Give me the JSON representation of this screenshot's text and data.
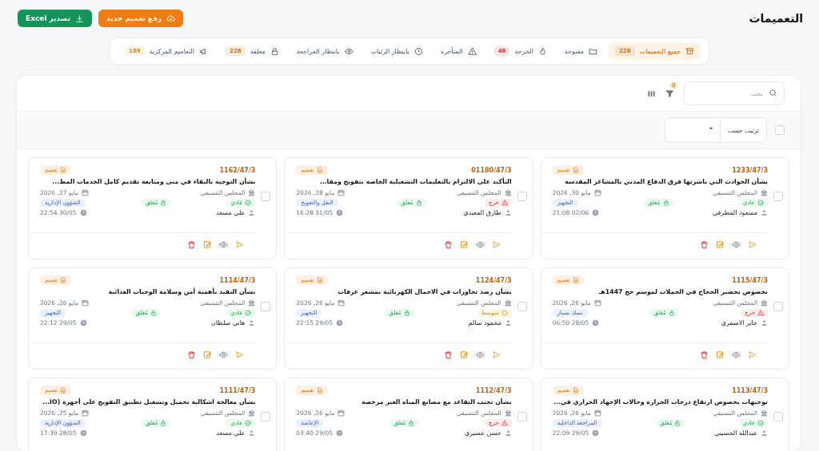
{
  "header": {
    "title": "التعميمات",
    "buttons": [
      {
        "label": "رفع تعميم جديد",
        "kind": "upload"
      },
      {
        "label": "تصدير Excel",
        "kind": "export"
      }
    ]
  },
  "tabs": [
    {
      "label": "جميع التعميمات",
      "count": "228",
      "color": "#d2700c",
      "selected": true
    },
    {
      "label": "مفتوحة",
      "selected": false
    },
    {
      "label": "الحرجة",
      "count": "48",
      "color": "#dd3333",
      "selected": false
    },
    {
      "label": "المتأخرة",
      "selected": false
    },
    {
      "label": "بانتظار الرئيات",
      "selected": false
    },
    {
      "label": "بانتظار المراجعة",
      "selected": false
    },
    {
      "label": "مغلقة",
      "count": "228",
      "color": "#d2700c",
      "selected": false
    },
    {
      "label": "التعاميم المركزية",
      "count": "189",
      "color": "#c99a06",
      "selected": false
    }
  ],
  "toolbar": {
    "search_placeholder": "بحث",
    "filter_count": "0"
  },
  "sort": {
    "label": "ترتيب حسب",
    "select_all_checked": false
  },
  "cards": [
    {
      "ref": "1233/47/3",
      "type": "تعميم",
      "title": "بشأن الحوادث التي باشرتها فرق الدفاع المدني بالمشاعر المقدسة",
      "council": "المجلس التنسيقي",
      "date": "مايو 30, 2026",
      "priority": {
        "kind": "normal",
        "label": "عادي"
      },
      "status": "مُغلق",
      "department": "التجهيز",
      "owner": "مسعود المطرفي",
      "time": "02/06 21:08",
      "checked": false
    },
    {
      "ref": "01180/47/3",
      "type": "تعميم",
      "title": "التأكيد على الالتزام بالتعليمات التشغيلية الخاصة بتفويج ومفا...",
      "council": "المجلس التنسيقي",
      "date": "مايو 28, 2026",
      "priority": {
        "kind": "critical",
        "label": "حرج"
      },
      "status": "مُغلق",
      "department": "النقل والتفويج",
      "owner": "طارق المعبدي",
      "time": "31/05 16:28",
      "checked": false
    },
    {
      "ref": "1162/47/3",
      "type": "تعميم",
      "title": "بشأن التوجيه بالبقاء في منى ومتابعة تقديم كامل الخدمات المط...",
      "council": "المجلس التنسيقي",
      "date": "مايو 27, 2026",
      "priority": {
        "kind": "normal",
        "label": "عادي"
      },
      "status": "مُغلق",
      "department": "الشؤون الإدارية",
      "owner": "علي مسعد",
      "time": "30/05 22:54",
      "checked": false
    },
    {
      "ref": "1115/47/3",
      "type": "تعميم",
      "title": "بخصوص تحضير الحجاج في الحملات لموسم حج 1447هـ",
      "council": "المجلس التنسيقي",
      "date": "مايو 26, 2026",
      "priority": {
        "kind": "critical",
        "label": "حرج"
      },
      "status": "مُغلق",
      "department": "نسك مسار",
      "owner": "جابر الاسمري",
      "time": "28/05 06:50",
      "checked": false
    },
    {
      "ref": "1124/47/3",
      "type": "تعميم",
      "title": "بشأن رصد تجاوزات في الاحمال الكهربائية بمشعر عرفات",
      "council": "المجلس التنسيقي",
      "date": "مايو 26, 2026",
      "priority": {
        "kind": "medium",
        "label": "متوسط"
      },
      "status": "مُغلق",
      "department": "التجهيز",
      "owner": "محمود سالم",
      "time": "29/05 22:15",
      "checked": false
    },
    {
      "ref": "1114/47/3",
      "type": "تعميم",
      "title": "بشأن التقيد بأهمية أمن وسلامة الوجبات الغذائية",
      "council": "المجلس التنسيقي",
      "date": "مايو 26, 2026",
      "priority": {
        "kind": "normal",
        "label": "عادي"
      },
      "status": "مُغلق",
      "department": "التجهيز",
      "owner": "هاني سلطان",
      "time": "29/05 22:12",
      "checked": false
    },
    {
      "ref": "1113/47/3",
      "type": "تعميم",
      "title": "توجيهات بخصوص ارتفاع درجات الحرارة وحالات الإجهاد الحراري في...",
      "council": "المجلس التنسيقي",
      "date": "مايو 26, 2026",
      "priority": {
        "kind": "normal",
        "label": "عادي"
      },
      "status": "مُغلق",
      "department": "المراجعة الداخلية",
      "owner": "عبدالله الحسيني",
      "time": "29/05 22:09",
      "checked": false
    },
    {
      "ref": "1112/47/3",
      "type": "تعميم",
      "title": "بشأن تجنب التقاعد مع مصانع المياه الغير مرخصة",
      "council": "المجلس التنسيقي",
      "date": "مايو 26, 2026",
      "priority": {
        "kind": "critical",
        "label": "حرج"
      },
      "status": "مُغلق",
      "department": "الإعاشة",
      "owner": "حسن عسيري",
      "time": "29/05 03:40",
      "checked": false
    },
    {
      "ref": "1111/47/3",
      "type": "تعميم",
      "title": "بشأن معالجة اشكالية تحميل وتشغيل تطبيق التفويج على أجهزة (IO...",
      "council": "المجلس التنسيقي",
      "date": "مايو 25, 2026",
      "priority": {
        "kind": "normal",
        "label": "عادي"
      },
      "status": "مُغلق",
      "department": "الشؤون الإدارية",
      "owner": "علي مسعد",
      "time": "28/05 17:39",
      "checked": false
    }
  ]
}
